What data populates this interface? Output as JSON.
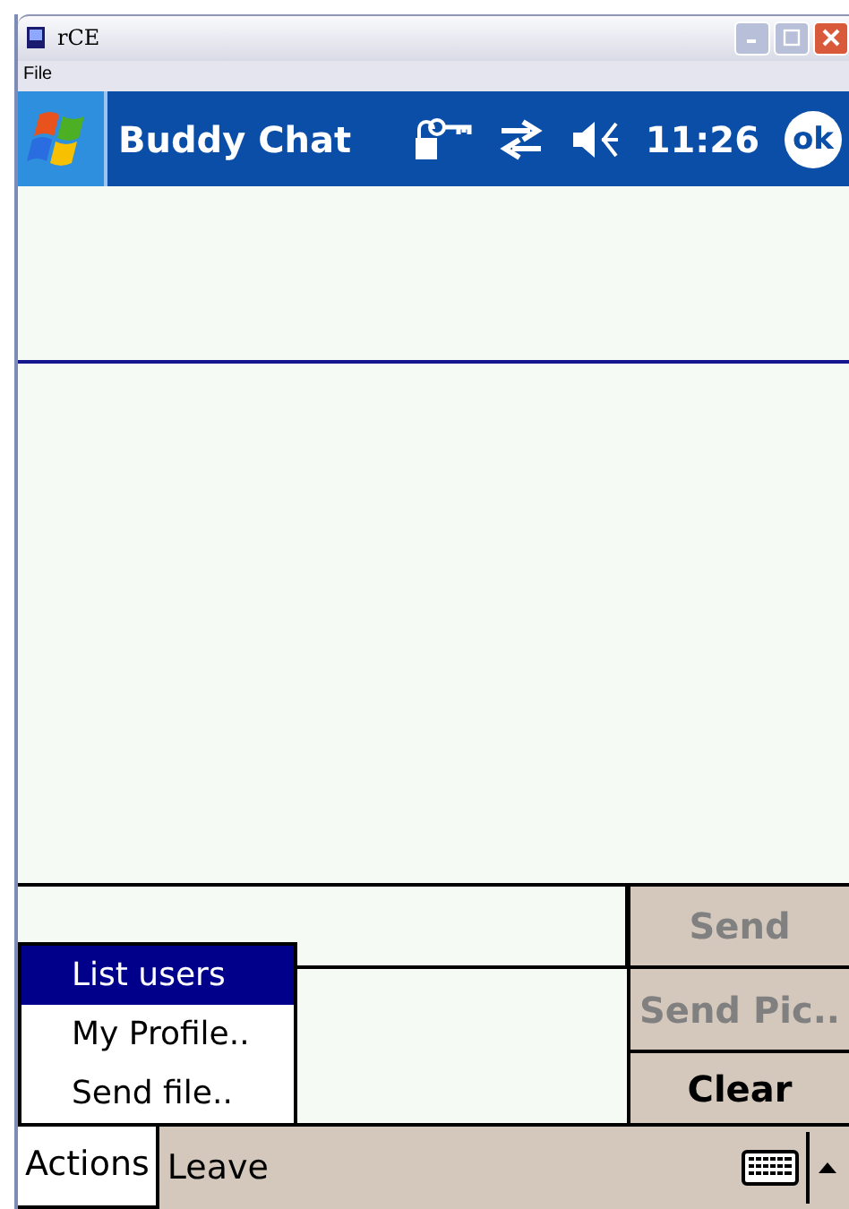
{
  "window": {
    "title": "rCE"
  },
  "menu_bar": [
    "File"
  ],
  "header": {
    "title": "Buddy Chat",
    "time": "11:26",
    "ok": "ok"
  },
  "buttons": [
    {
      "label": "Send",
      "disabled": true
    },
    {
      "label": "Send Pic..",
      "disabled": true
    },
    {
      "label": "Clear",
      "disabled": false
    }
  ],
  "popup_menu": [
    {
      "label": "List users",
      "selected": true
    },
    {
      "label": "My Profile..",
      "selected": false
    },
    {
      "label": "Send file..",
      "selected": false
    }
  ],
  "softkeys": [
    {
      "label": "Actions",
      "selected": true
    },
    {
      "label": "Leave",
      "selected": false
    }
  ]
}
